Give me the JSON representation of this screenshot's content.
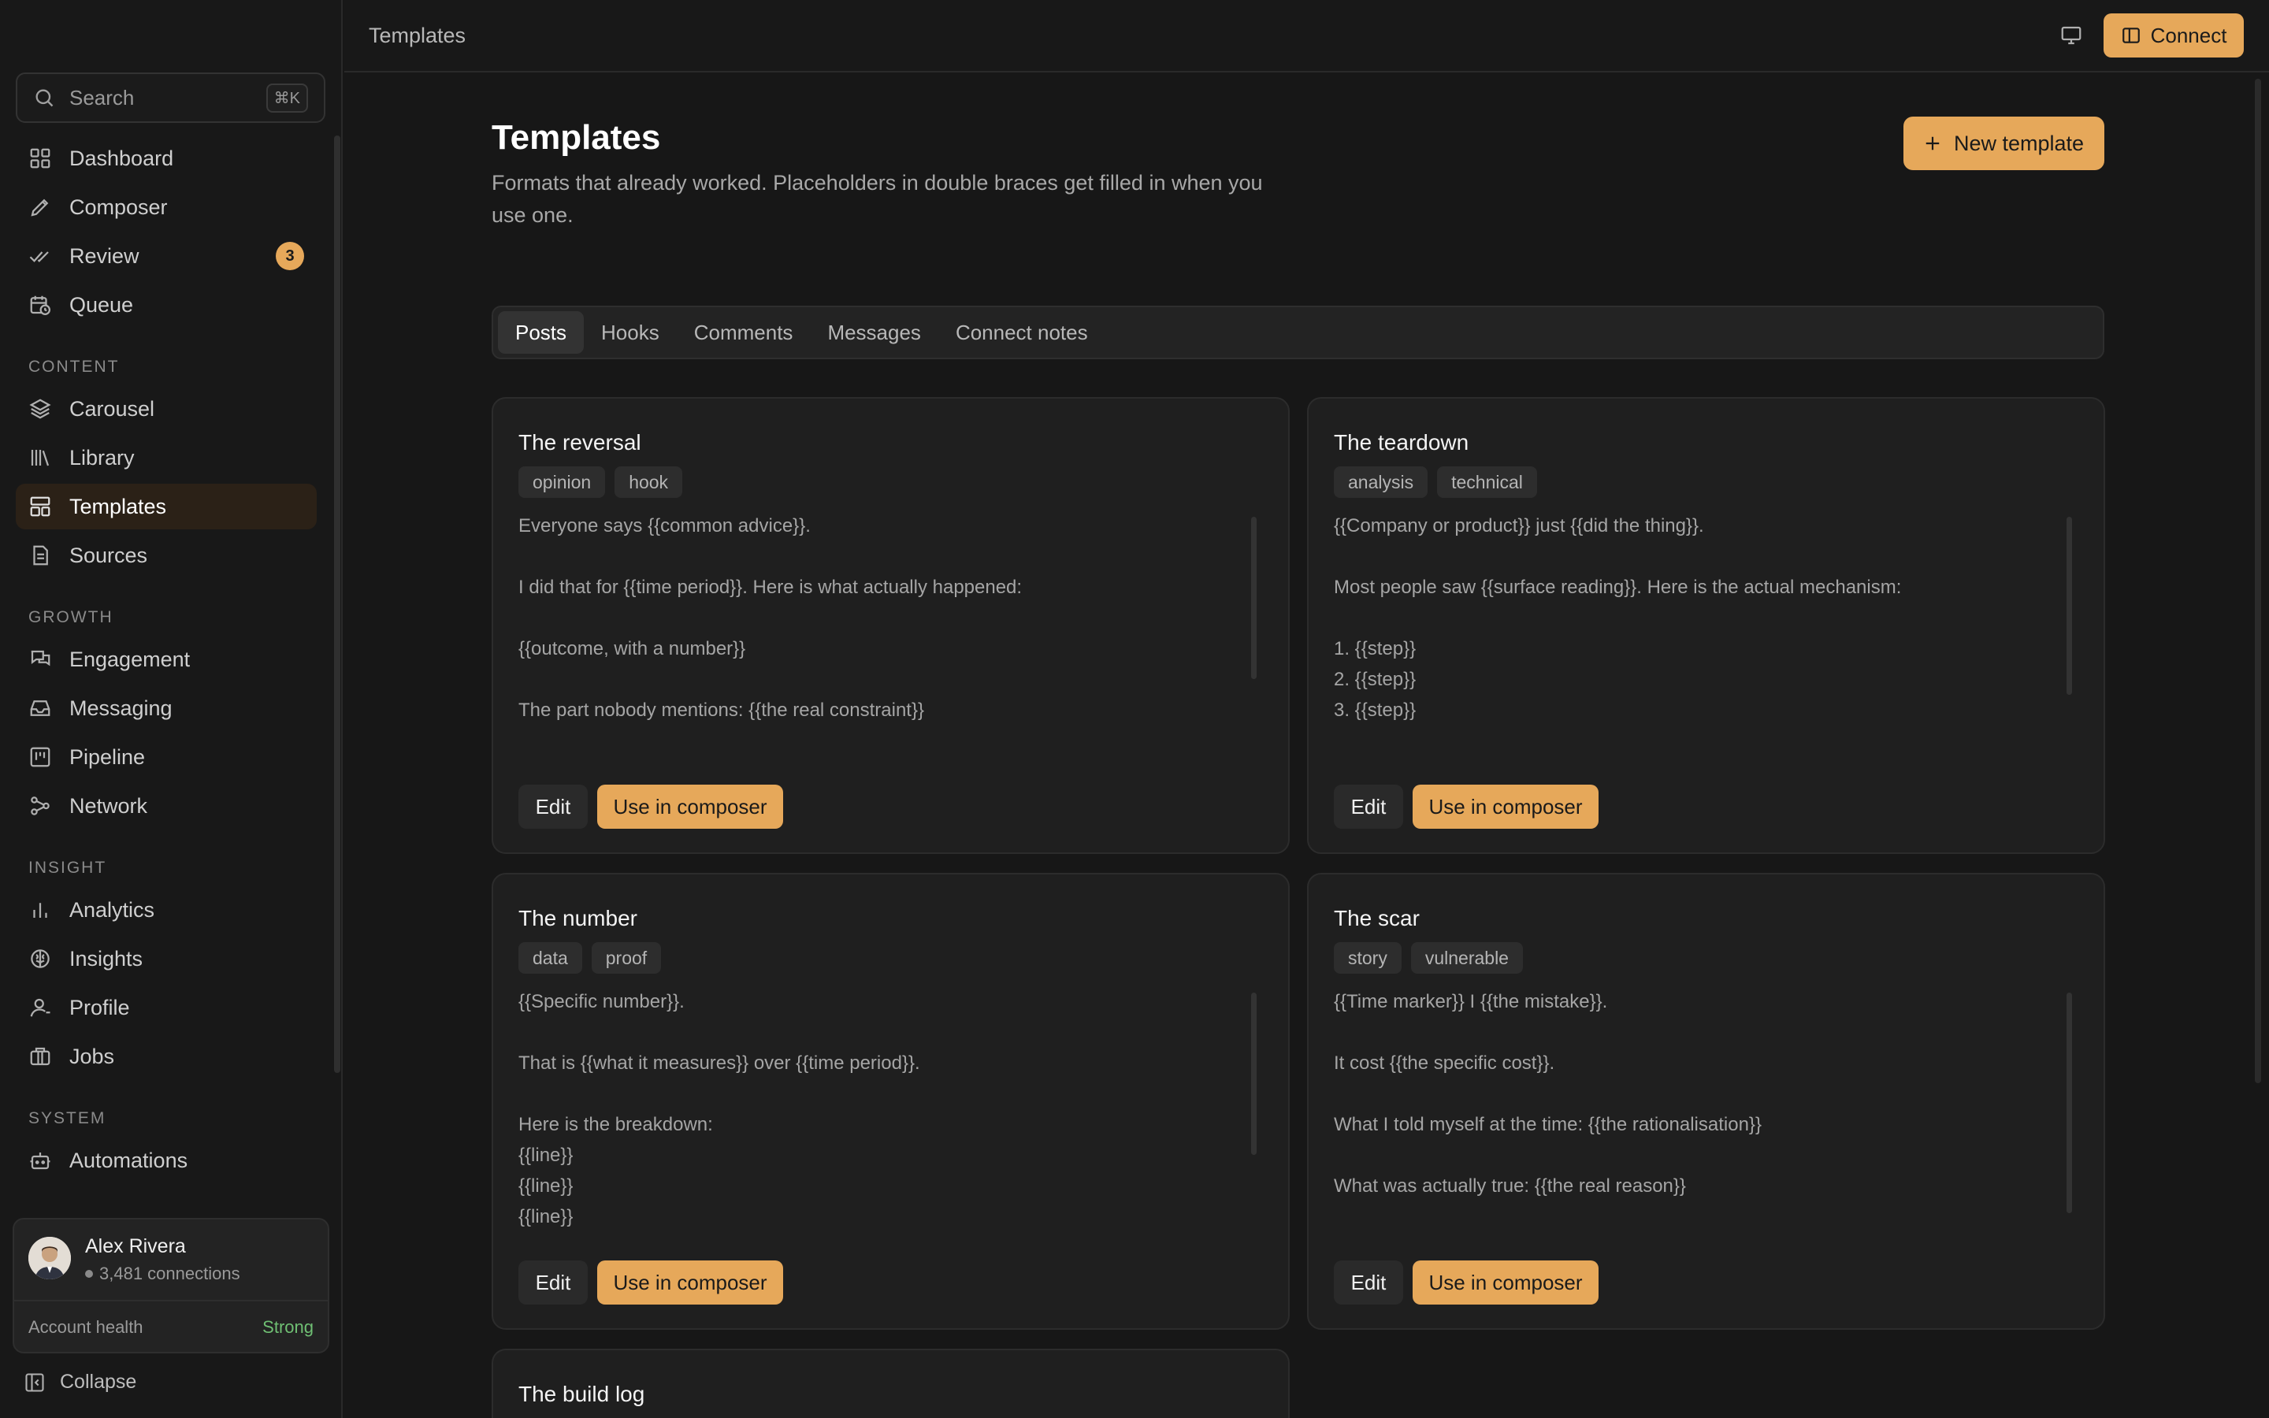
{
  "app": {
    "accent": "#e6a85a"
  },
  "search": {
    "placeholder": "Search",
    "shortcut": "⌘K"
  },
  "nav": {
    "main": [
      {
        "label": "Dashboard",
        "icon": "grid-icon"
      },
      {
        "label": "Composer",
        "icon": "pen-icon"
      },
      {
        "label": "Review",
        "icon": "double-check-icon",
        "badge": "3"
      },
      {
        "label": "Queue",
        "icon": "calendar-clock-icon"
      }
    ],
    "content_heading": "CONTENT",
    "content": [
      {
        "label": "Carousel",
        "icon": "layers-icon"
      },
      {
        "label": "Library",
        "icon": "library-icon"
      },
      {
        "label": "Templates",
        "icon": "layout-icon",
        "active": true
      },
      {
        "label": "Sources",
        "icon": "file-icon"
      }
    ],
    "growth_heading": "GROWTH",
    "growth": [
      {
        "label": "Engagement",
        "icon": "chat-icon"
      },
      {
        "label": "Messaging",
        "icon": "inbox-icon"
      },
      {
        "label": "Pipeline",
        "icon": "kanban-icon"
      },
      {
        "label": "Network",
        "icon": "network-icon"
      }
    ],
    "insight_heading": "INSIGHT",
    "insight": [
      {
        "label": "Analytics",
        "icon": "bar-chart-icon"
      },
      {
        "label": "Insights",
        "icon": "brain-icon"
      },
      {
        "label": "Profile",
        "icon": "user-icon"
      },
      {
        "label": "Jobs",
        "icon": "briefcase-icon"
      }
    ],
    "system_heading": "SYSTEM",
    "system": [
      {
        "label": "Automations",
        "icon": "bot-icon"
      }
    ]
  },
  "user": {
    "name": "Alex Rivera",
    "connections": "3,481 connections",
    "health_label": "Account health",
    "health_value": "Strong"
  },
  "collapse_label": "Collapse",
  "topbar": {
    "breadcrumb": "Templates",
    "connect_label": "Connect"
  },
  "page": {
    "title": "Templates",
    "subtitle": "Formats that already worked. Placeholders in double braces get filled in when you use one.",
    "new_button": "New template"
  },
  "tabs": [
    "Posts",
    "Hooks",
    "Comments",
    "Messages",
    "Connect notes"
  ],
  "cards": [
    {
      "title": "The reversal",
      "tags": [
        "opinion",
        "hook"
      ],
      "body": "Everyone says {{common advice}}.\n\nI did that for {{time period}}. Here is what actually happened:\n\n{{outcome, with a number}}\n\nThe part nobody mentions: {{the real constraint}}",
      "edit": "Edit",
      "use": "Use in composer"
    },
    {
      "title": "The teardown",
      "tags": [
        "analysis",
        "technical"
      ],
      "body": "{{Company or product}} just {{did the thing}}.\n\nMost people saw {{surface reading}}. Here is the actual mechanism:\n\n1. {{step}}\n2. {{step}}\n3. {{step}}",
      "edit": "Edit",
      "use": "Use in composer"
    },
    {
      "title": "The number",
      "tags": [
        "data",
        "proof"
      ],
      "body": "{{Specific number}}.\n\nThat is {{what it measures}} over {{time period}}.\n\nHere is the breakdown:\n{{line}}\n{{line}}\n{{line}}",
      "edit": "Edit",
      "use": "Use in composer"
    },
    {
      "title": "The scar",
      "tags": [
        "story",
        "vulnerable"
      ],
      "body": "{{Time marker}} I {{the mistake}}.\n\nIt cost {{the specific cost}}.\n\nWhat I told myself at the time: {{the rationalisation}}\n\nWhat was actually true: {{the real reason}}",
      "edit": "Edit",
      "use": "Use in composer"
    },
    {
      "title": "The build log"
    }
  ]
}
